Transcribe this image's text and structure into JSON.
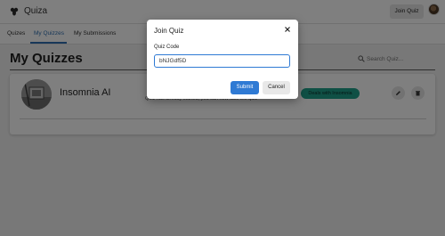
{
  "app": {
    "brand": "Quiza",
    "join_button": "Join Quiz"
  },
  "tabs": [
    {
      "label": "Quizes"
    },
    {
      "label": "My Quizzes",
      "active": true
    },
    {
      "label": "My Submissions"
    }
  ],
  "search": {
    "placeholder": "Search Quiz..."
  },
  "main": {
    "title": "My Quizzes"
  },
  "quizzes": [
    {
      "name": "Insomnia AI",
      "description": "Quiz has already started, you can now take the quiz",
      "tag": "Deals with Insomnia"
    }
  ],
  "modal": {
    "title": "Join Quiz",
    "field_label": "Quiz Code",
    "code_value": "bNJGdf5D",
    "submit_label": "Submit",
    "cancel_label": "Cancel"
  },
  "colors": {
    "accent": "#2f7ad4",
    "tab_active": "#2f6fb0",
    "tag_bg": "#1fa08b",
    "backdrop": "rgba(0,0,0,0.5)"
  },
  "icons": [
    "bee-logo-icon",
    "search-icon",
    "edit-pencil-icon",
    "trash-icon",
    "close-icon"
  ]
}
